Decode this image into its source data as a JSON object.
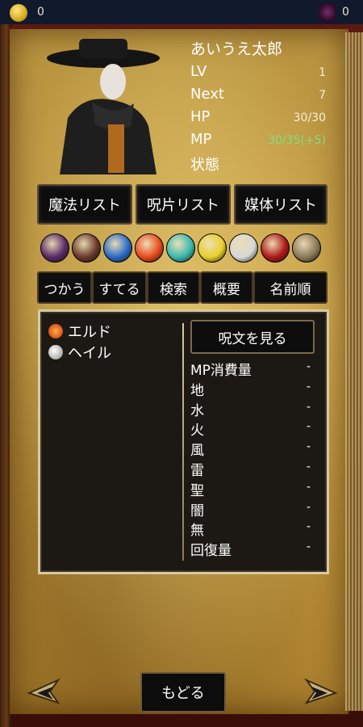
{
  "topbar": {
    "coins": "0",
    "gems": "0"
  },
  "character": {
    "name": "あいうえ太郎",
    "lv_label": "LV",
    "lv": "1",
    "next_label": "Next",
    "next": "7",
    "hp_label": "HP",
    "hp": "30/30",
    "mp_label": "MP",
    "mp": "30/35(+5)",
    "status_label": "状態"
  },
  "tabs": [
    "魔法リスト",
    "呪片リスト",
    "媒体リスト"
  ],
  "elements": [
    {
      "icon": "dark-vortex-icon",
      "color": "#5a2a6a"
    },
    {
      "icon": "earth-orb-icon",
      "color": "#6a3a2a"
    },
    {
      "icon": "water-drop-icon",
      "color": "#2a6ac8"
    },
    {
      "icon": "fire-icon",
      "color": "#e84a1a"
    },
    {
      "icon": "wind-swirl-icon",
      "color": "#3ab8b0"
    },
    {
      "icon": "lightning-icon",
      "color": "#e8d02a"
    },
    {
      "icon": "holy-orb-icon",
      "color": "#d8d8d8"
    },
    {
      "icon": "blood-orb-icon",
      "color": "#b01818"
    },
    {
      "icon": "null-slash-icon",
      "color": "#8a7a5a"
    }
  ],
  "actions": [
    "つかう",
    "すてる",
    "検索",
    "概要",
    "名前順"
  ],
  "spell_list": [
    {
      "name": "エルド",
      "icon": "fire-orb-icon"
    },
    {
      "name": "ヘイル",
      "icon": "holy-orb-icon"
    }
  ],
  "view_button": "呪文を見る",
  "properties": [
    {
      "label": "MP消費量",
      "value": "-"
    },
    {
      "label": "地",
      "value": "-"
    },
    {
      "label": "水",
      "value": "-"
    },
    {
      "label": "火",
      "value": "-"
    },
    {
      "label": "風",
      "value": "-"
    },
    {
      "label": "雷",
      "value": "-"
    },
    {
      "label": "聖",
      "value": "-"
    },
    {
      "label": "闇",
      "value": "-"
    },
    {
      "label": "無",
      "value": "-"
    },
    {
      "label": "回復量",
      "value": "-"
    }
  ],
  "back_button": "もどる"
}
